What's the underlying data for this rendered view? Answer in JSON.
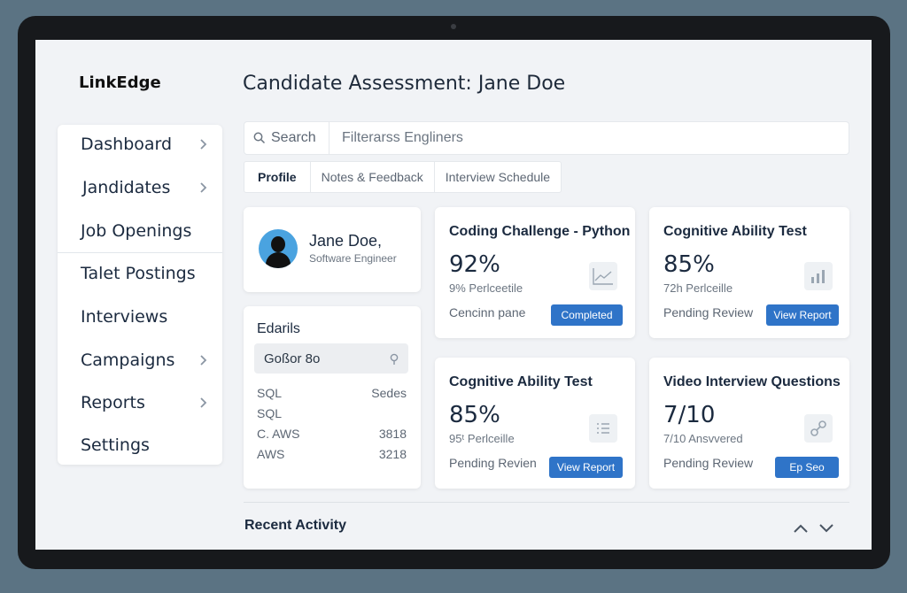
{
  "app": {
    "logo": "LinkEdge",
    "page_title": "Candidate Assessment: Jane Doe"
  },
  "sidebar": {
    "items": [
      {
        "label": "Dashboard",
        "chevron": true
      },
      {
        "label": "Jandidates",
        "chevron": true
      },
      {
        "label": "Job Openings",
        "chevron": false
      },
      {
        "label": "Talet Postings",
        "chevron": false
      },
      {
        "label": "Interviews",
        "chevron": false
      },
      {
        "label": "Campaigns",
        "chevron": true
      },
      {
        "label": "Reports",
        "chevron": true
      },
      {
        "label": "Settings",
        "chevron": false
      }
    ]
  },
  "search": {
    "label": "Search",
    "placeholder": "Filterarss Engliners"
  },
  "tabs": [
    {
      "label": "Profile",
      "active": true
    },
    {
      "label": "Notes & Feedback",
      "active": false
    },
    {
      "label": "Interview Schedule",
      "active": false
    }
  ],
  "profile": {
    "name": "Jane Doe,",
    "role": "Software Engineer"
  },
  "details": {
    "title": "Edarils",
    "select_value": "Goßor 8o",
    "rows": [
      {
        "left": "SQL",
        "right": "Sedes"
      },
      {
        "left": "SQL",
        "right": ""
      },
      {
        "left": "C. AWS",
        "right": "3818"
      },
      {
        "left": "AWS",
        "right": "3218"
      }
    ]
  },
  "assessments": [
    {
      "title": "Coding Challenge - Python",
      "score": "92%",
      "percentile": "9% Perlceetile",
      "status": "Cencinn pane",
      "button": "Completed",
      "icon": "line-chart-icon"
    },
    {
      "title": "Cognitive Ability Test",
      "score": "85%",
      "percentile": "72h Perlceille",
      "status": "Pending Review",
      "button": "View Report",
      "icon": "bar-chart-icon"
    },
    {
      "title": "Cognitive Ability Test",
      "score": "85%",
      "percentile": "95ᵗ Perlceille",
      "status": "Pending Revien",
      "button": "View Report",
      "icon": "list-icon"
    },
    {
      "title": "Video Interview Questions",
      "score": "7/10",
      "percentile": "7/10 Ansvvered",
      "status": "Pending Review",
      "button": "Ep Seo",
      "icon": "link-icon"
    }
  ],
  "recent": {
    "title": "Recent Activity"
  },
  "colors": {
    "accent": "#2f74c8",
    "background": "#f1f3f6",
    "avatar": "#4aa3e0"
  }
}
